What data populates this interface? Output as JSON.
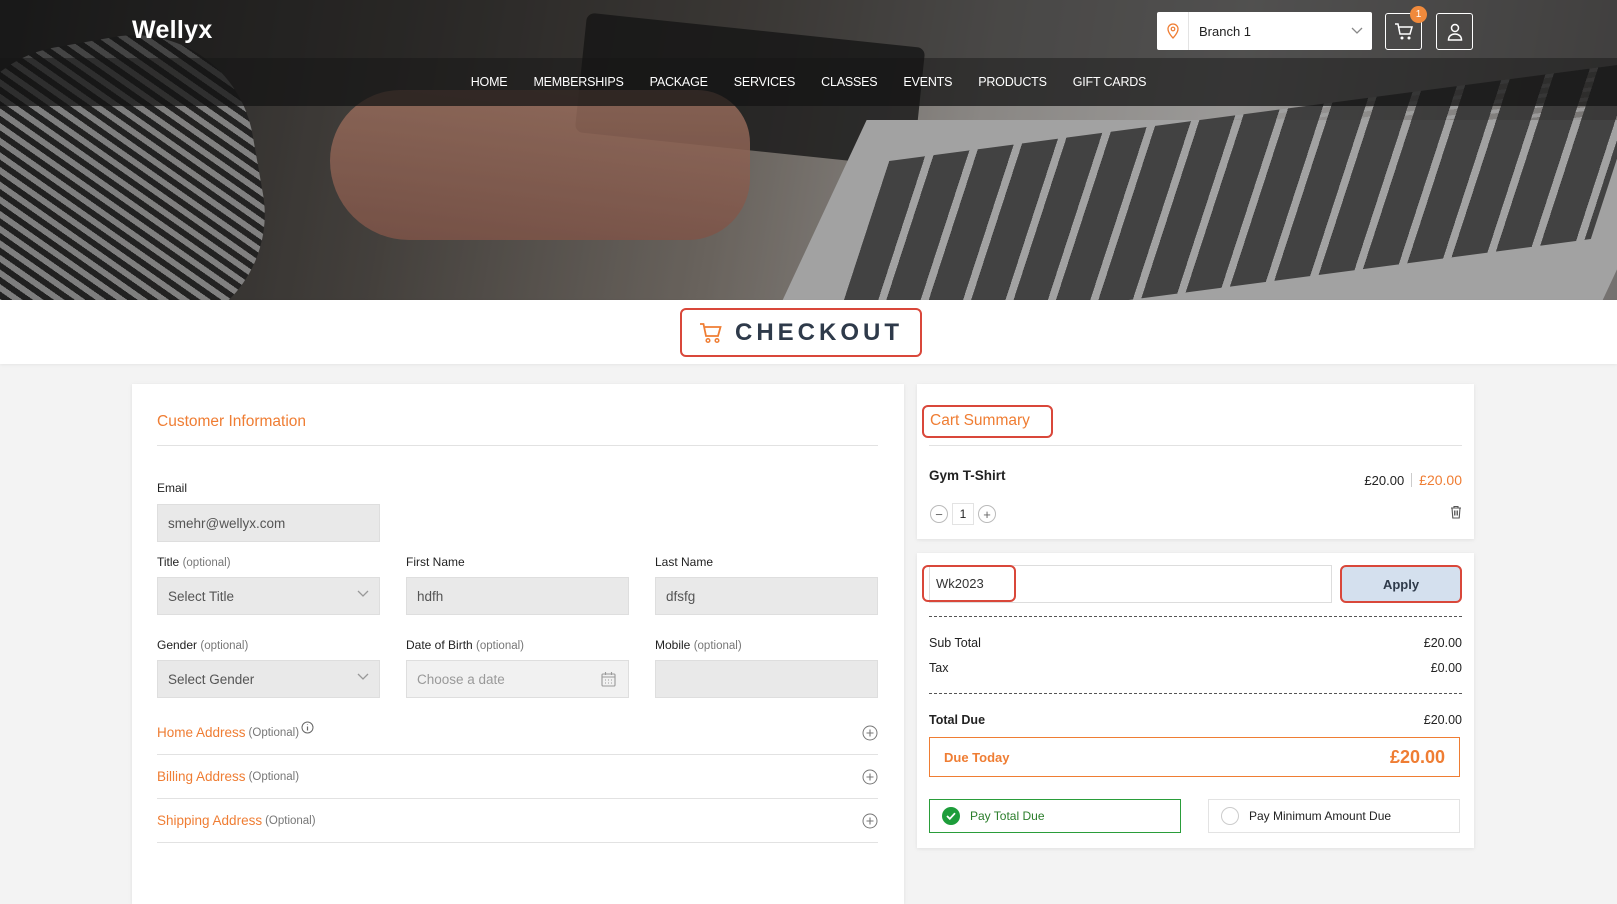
{
  "header": {
    "logo": "Wellyx",
    "branch": "Branch 1",
    "cart_count": "1"
  },
  "nav": [
    "HOME",
    "MEMBERSHIPS",
    "PACKAGE",
    "SERVICES",
    "CLASSES",
    "EVENTS",
    "PRODUCTS",
    "GIFT CARDS"
  ],
  "page_title": "CHECKOUT",
  "customer": {
    "title": "Customer Information",
    "email_label": "Email",
    "email_value": "smehr@wellyx.com",
    "title_label": "Title",
    "optional": "(optional)",
    "title_value": "Select Title",
    "first_name_label": "First Name",
    "first_name_value": "hdfh",
    "last_name_label": "Last Name",
    "last_name_value": "dfsfg",
    "gender_label": "Gender",
    "gender_value": "Select Gender",
    "dob_label": "Date of Birth",
    "dob_placeholder": "Choose a date",
    "mobile_label": "Mobile",
    "mobile_value": "",
    "home_address": "Home Address",
    "billing_address": "Billing Address",
    "shipping_address": "Shipping Address",
    "optional_cap": "(Optional)"
  },
  "cart": {
    "title": "Cart Summary",
    "item_name": "Gym T-Shirt",
    "item_price": "£20.00",
    "item_total": "£20.00",
    "quantity": "1",
    "minus": "−",
    "plus": "+"
  },
  "totals": {
    "coupon_value": "Wk2023",
    "apply_label": "Apply",
    "sub_total_label": "Sub Total",
    "sub_total_value": "£20.00",
    "tax_label": "Tax",
    "tax_value": "£0.00",
    "total_due_label": "Total Due",
    "total_due_value": "£20.00",
    "due_today_label": "Due Today",
    "due_today_value": "£20.00",
    "pay_total_label": "Pay Total Due",
    "pay_min_label": "Pay Minimum Amount Due"
  },
  "colors": {
    "accent": "#ef7d33",
    "highlight": "#d9473a",
    "success": "#1d9d3a"
  }
}
